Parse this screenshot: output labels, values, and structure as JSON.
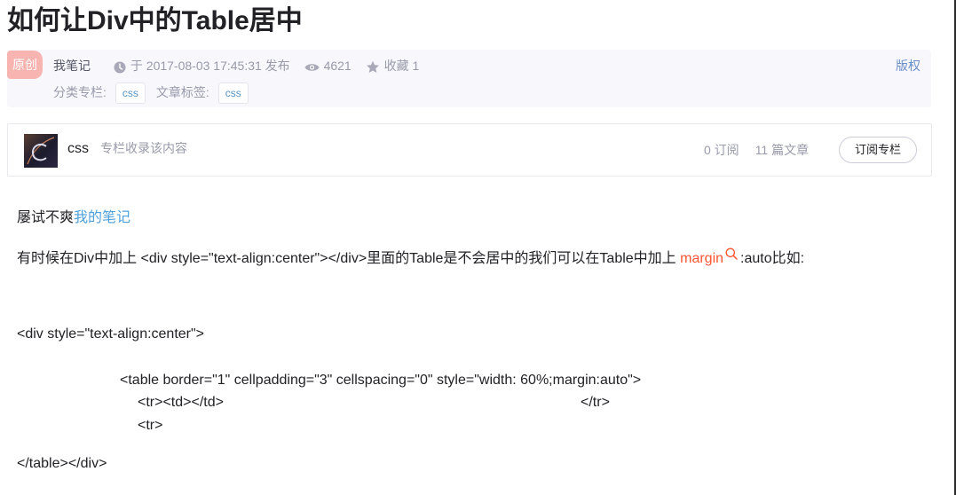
{
  "article": {
    "title": "如何让Div中的Table居中"
  },
  "meta": {
    "badge": "原创",
    "author": "我笔记",
    "published": "于 2017-08-03 17:45:31 发布",
    "views": "4621",
    "favorites": "收藏 1",
    "copyright": "版权",
    "category_label": "分类专栏:",
    "category_tag": "css",
    "article_tag_label": "文章标签:",
    "article_tag": "css"
  },
  "column": {
    "name": "css",
    "description": "专栏收录该内容",
    "subscribers": "0 订阅",
    "articles": "11 篇文章",
    "subscribe_button": "订阅专栏"
  },
  "body": {
    "line1_text": "屡试不爽",
    "line1_link": "我的笔记",
    "line2_before": "有时候在Div中加上 <div style=\"text-align:center\"></div>里面的Table是不会居中的我们可以在Table中加上 ",
    "line2_keyword": "margin",
    "line2_after": ":auto比如:",
    "code1": "<div style=\"text-align:center\">",
    "code2": "<table border=\"1\" cellpadding=\"3\" cellspacing=\"0\" style=\"width: 60%;margin:auto\">",
    "code3a": "<tr><td></td>",
    "code3b": "</tr>",
    "code4": "<tr>",
    "code5": "</table></div>"
  },
  "colors": {
    "link": "#4ea1db",
    "keyword": "#fc5531",
    "badge": "#f8b4b0"
  },
  "icons": [
    "clock-icon",
    "eye-icon",
    "star-icon",
    "search-icon"
  ]
}
